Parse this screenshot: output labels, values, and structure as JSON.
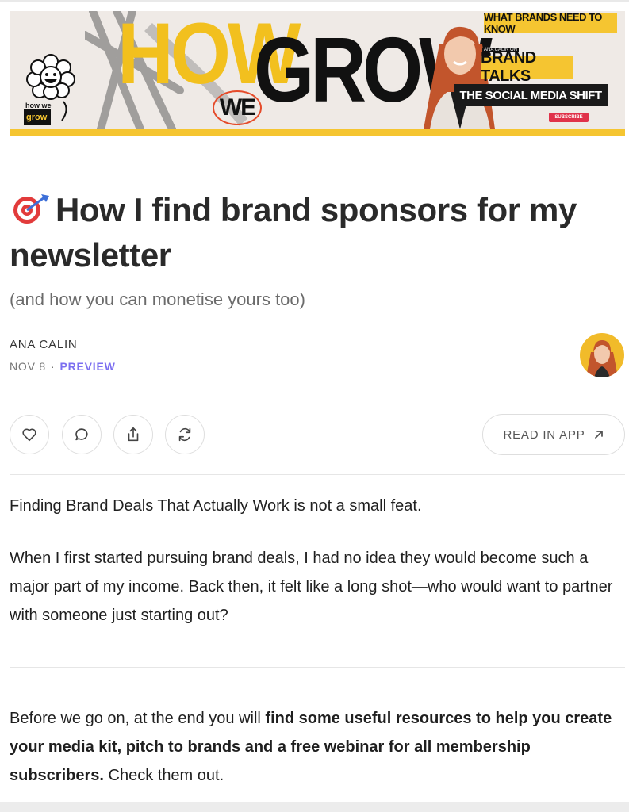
{
  "banner": {
    "logo_text_top": "how we",
    "logo_text_bottom": "grow",
    "word_how": "HOW",
    "word_we": "WE",
    "word_grow": "GROW",
    "tag_top": "WHAT BRANDS NEED TO KNOW",
    "tag_small": "ANA CALIN ON",
    "tag_brand": "BRAND TALKS",
    "tag_social": "THE SOCIAL MEDIA SHIFT",
    "subscribe": "SUBSCRIBE"
  },
  "post": {
    "title": "How I find brand sponsors for my newsletter",
    "subtitle": "(and how you can monetise yours too)",
    "author": "ANA CALIN",
    "date": "NOV 8",
    "separator": "·",
    "preview": "PREVIEW"
  },
  "actions": {
    "icons": [
      "heart-icon",
      "comment-icon",
      "share-icon",
      "restack-icon"
    ],
    "read_in_app": "READ IN APP"
  },
  "body": {
    "p1": "Finding Brand Deals That Actually Work is not a small feat.",
    "p2": "When I first started pursuing brand deals, I had no idea they would become such a major part of my income. Back then, it felt like a long shot—who would want to partner with someone just starting out?",
    "p3_lead": "Before we go on, at the end you will ",
    "p3_bold": "find some useful resources to help you create your media kit, pitch to brands and a free webinar for all membership subscribers.",
    "p3_tail": " Check them out."
  },
  "colors": {
    "accent": "#7c6ff0",
    "banner_yellow": "#f5c531",
    "text": "#1f1f1f"
  }
}
